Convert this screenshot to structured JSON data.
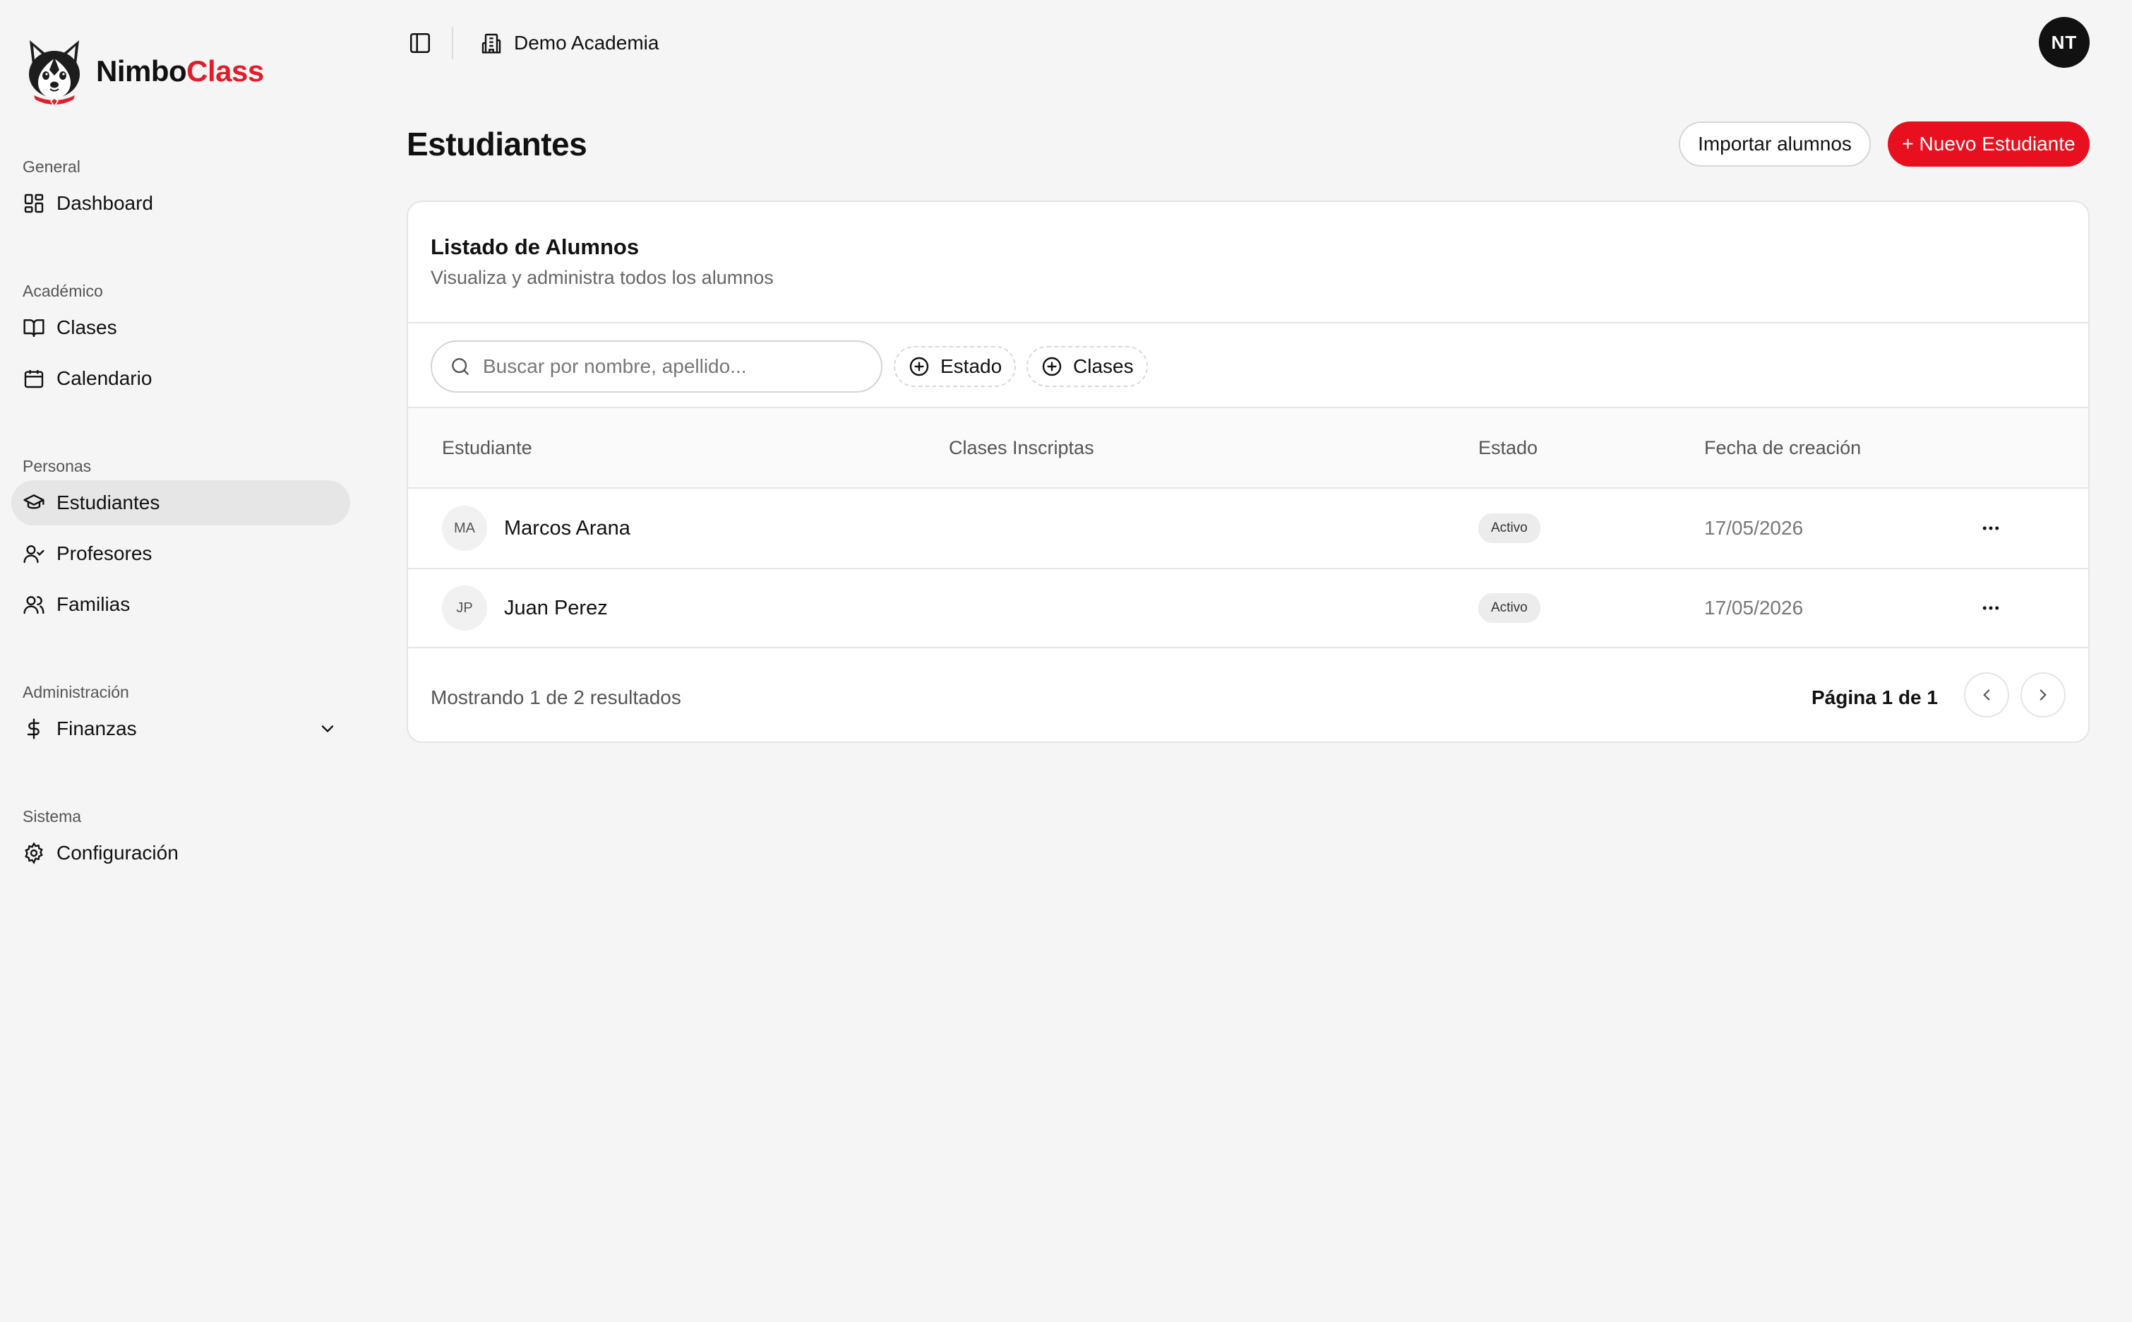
{
  "brand": {
    "name_part1": "Nimbo",
    "name_part2": "Class",
    "accent_color": "#e11d2a"
  },
  "topbar": {
    "organization": "Demo Academia",
    "user_initials": "NT"
  },
  "sidebar": {
    "sections": [
      {
        "heading": "General",
        "items": [
          {
            "label": "Dashboard",
            "icon": "dashboard-icon"
          }
        ]
      },
      {
        "heading": "Académico",
        "items": [
          {
            "label": "Clases",
            "icon": "book-icon"
          },
          {
            "label": "Calendario",
            "icon": "calendar-icon"
          }
        ]
      },
      {
        "heading": "Personas",
        "items": [
          {
            "label": "Estudiantes",
            "icon": "graduation-cap-icon",
            "active": true
          },
          {
            "label": "Profesores",
            "icon": "user-check-icon"
          },
          {
            "label": "Familias",
            "icon": "users-icon"
          }
        ]
      },
      {
        "heading": "Administración",
        "items": [
          {
            "label": "Finanzas",
            "icon": "dollar-icon",
            "expandable": true
          }
        ]
      },
      {
        "heading": "Sistema",
        "items": [
          {
            "label": "Configuración",
            "icon": "gear-icon"
          }
        ]
      }
    ]
  },
  "page": {
    "title": "Estudiantes",
    "import_button": "Importar alumnos",
    "new_button": "+ Nuevo Estudiante",
    "primary_color": "#e8101e"
  },
  "card": {
    "title": "Listado de Alumnos",
    "subtitle": "Visualiza y administra todos los alumnos",
    "search_placeholder": "Buscar por nombre, apellido...",
    "filters": [
      "Estado",
      "Clases"
    ],
    "columns": [
      "Estudiante",
      "Clases Inscriptas",
      "Estado",
      "Fecha de creación"
    ],
    "rows": [
      {
        "initials": "MA",
        "name": "Marcos Arana",
        "classes": "",
        "status": "Activo",
        "created": "17/05/2026"
      },
      {
        "initials": "JP",
        "name": "Juan Perez",
        "classes": "",
        "status": "Activo",
        "created": "17/05/2026"
      }
    ],
    "footer": "Mostrando 1 de 2 resultados",
    "page_info": "Página 1 de 1"
  }
}
